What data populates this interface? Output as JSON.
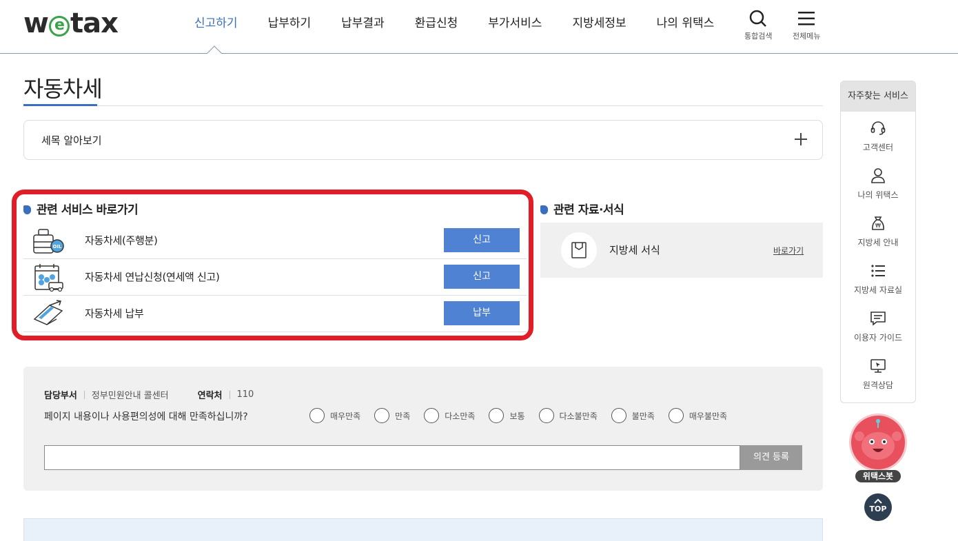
{
  "header": {
    "logo": {
      "pre": "w",
      "e": "e",
      "post": "tax"
    },
    "nav": [
      "신고하기",
      "납부하기",
      "납부결과",
      "환급신청",
      "부가서비스",
      "지방세정보",
      "나의 위택스"
    ],
    "search_label": "통합검색",
    "menu_label": "전체메뉴"
  },
  "page": {
    "title": "자동차세",
    "accordion_label": "세목 알아보기"
  },
  "services": {
    "heading": "관련 서비스 바로가기",
    "items": [
      {
        "name": "자동차세(주행분)",
        "button": "신고",
        "icon": "fuel-tank-oil-icon"
      },
      {
        "name": "자동차세 연납신청(연세액 신고)",
        "button": "신고",
        "icon": "calendar-car-icon"
      },
      {
        "name": "자동차세 납부",
        "button": "납부",
        "icon": "card-payment-icon"
      }
    ]
  },
  "docs": {
    "heading": "관련 자료·서식",
    "item": "지방세 서식",
    "link": "바로가기"
  },
  "survey": {
    "dept_label": "담당부서",
    "dept_value": "정부민원안내 콜센터",
    "contact_label": "연락처",
    "contact_value": "110",
    "question": "페이지 내용이나 사용편의성에 대해 만족하십니까?",
    "options": [
      "매우만족",
      "만족",
      "다소만족",
      "보통",
      "다소불만족",
      "불만족",
      "매우불만족"
    ],
    "submit": "의견 등록"
  },
  "quick_menu": {
    "heading": "자주찾는 서비스",
    "items": [
      "고객센터",
      "나의 위택스",
      "지방세 안내",
      "지방세 자료실",
      "이용자 가이드",
      "원격상담"
    ]
  },
  "bot_label": "위택스봇",
  "top_label": "TOP",
  "colors": {
    "accent": "#3a6fbf",
    "button": "#4f82d3",
    "highlight": "#e01e28"
  }
}
